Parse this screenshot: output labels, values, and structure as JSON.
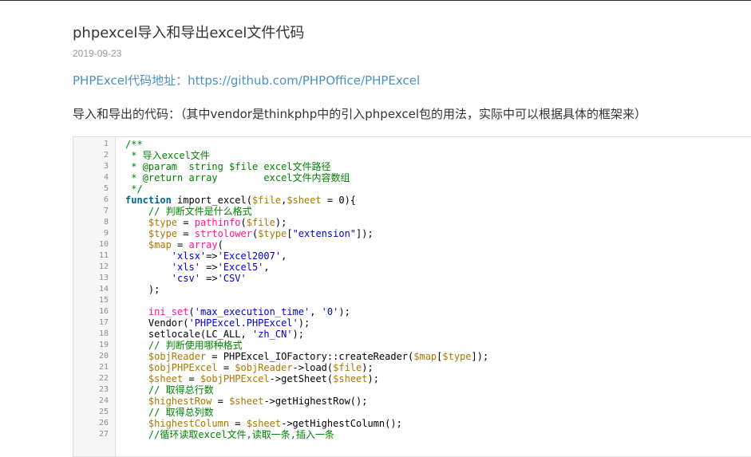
{
  "article": {
    "title": "phpexcel导入和导出excel文件代码",
    "date": "2019-09-23",
    "source_label": "PHPExcel代码地址",
    "source_colon": "：",
    "source_url": "https://github.com/PHPOffice/PHPExcel",
    "intro": "导入和导出的代码：（其中vendor是thinkphp中的引入phpexcel包的用法，实际中可以根据具体的框架来）"
  },
  "code": {
    "line_numbers": [
      "1",
      "2",
      "3",
      "4",
      "5",
      "6",
      "7",
      "8",
      "9",
      "10",
      "11",
      "12",
      "13",
      "14",
      "15",
      "16",
      "17",
      "18",
      "19",
      "20",
      "21",
      "22",
      "23",
      "24",
      "25",
      "26",
      "27"
    ],
    "lines": [
      [
        {
          "t": "/**",
          "c": "cm"
        }
      ],
      [
        {
          "t": " * 导入excel文件",
          "c": "cm"
        }
      ],
      [
        {
          "t": " * @param  string $file excel文件路径",
          "c": "cm"
        }
      ],
      [
        {
          "t": " * @return array        excel文件内容数组",
          "c": "cm"
        }
      ],
      [
        {
          "t": " */",
          "c": "cm"
        }
      ],
      [
        {
          "t": "function",
          "c": "kw"
        },
        {
          "t": " import_excel(",
          "c": "pl"
        },
        {
          "t": "$file",
          "c": "var"
        },
        {
          "t": ",",
          "c": "pl"
        },
        {
          "t": "$sheet",
          "c": "var"
        },
        {
          "t": " = 0){",
          "c": "pl"
        }
      ],
      [
        {
          "t": "    // 判断文件是什么格式",
          "c": "cm"
        }
      ],
      [
        {
          "t": "    ",
          "c": "pl"
        },
        {
          "t": "$type",
          "c": "var"
        },
        {
          "t": " = ",
          "c": "pl"
        },
        {
          "t": "pathinfo",
          "c": "fn"
        },
        {
          "t": "(",
          "c": "pl"
        },
        {
          "t": "$file",
          "c": "var"
        },
        {
          "t": ");",
          "c": "pl"
        }
      ],
      [
        {
          "t": "    ",
          "c": "pl"
        },
        {
          "t": "$type",
          "c": "var"
        },
        {
          "t": " = ",
          "c": "pl"
        },
        {
          "t": "strtolower",
          "c": "fn"
        },
        {
          "t": "(",
          "c": "pl"
        },
        {
          "t": "$type",
          "c": "var"
        },
        {
          "t": "[",
          "c": "pl"
        },
        {
          "t": "\"extension\"",
          "c": "st"
        },
        {
          "t": "]);",
          "c": "pl"
        }
      ],
      [
        {
          "t": "    ",
          "c": "pl"
        },
        {
          "t": "$map",
          "c": "var"
        },
        {
          "t": " = ",
          "c": "pl"
        },
        {
          "t": "array",
          "c": "fn"
        },
        {
          "t": "(",
          "c": "pl"
        }
      ],
      [
        {
          "t": "        ",
          "c": "pl"
        },
        {
          "t": "'xlsx'",
          "c": "st"
        },
        {
          "t": "=>",
          "c": "pl"
        },
        {
          "t": "'Excel2007'",
          "c": "st"
        },
        {
          "t": ",",
          "c": "pl"
        }
      ],
      [
        {
          "t": "        ",
          "c": "pl"
        },
        {
          "t": "'xls'",
          "c": "st"
        },
        {
          "t": " =>",
          "c": "pl"
        },
        {
          "t": "'Excel5'",
          "c": "st"
        },
        {
          "t": ",",
          "c": "pl"
        }
      ],
      [
        {
          "t": "        ",
          "c": "pl"
        },
        {
          "t": "'csv'",
          "c": "st"
        },
        {
          "t": " =>",
          "c": "pl"
        },
        {
          "t": "'CSV'",
          "c": "st"
        }
      ],
      [
        {
          "t": "    );",
          "c": "pl"
        }
      ],
      [
        {
          "t": "",
          "c": "pl"
        }
      ],
      [
        {
          "t": "    ",
          "c": "pl"
        },
        {
          "t": "ini_set",
          "c": "fn"
        },
        {
          "t": "(",
          "c": "pl"
        },
        {
          "t": "'max_execution_time'",
          "c": "st"
        },
        {
          "t": ", ",
          "c": "pl"
        },
        {
          "t": "'0'",
          "c": "st"
        },
        {
          "t": ");",
          "c": "pl"
        }
      ],
      [
        {
          "t": "    Vendor(",
          "c": "pl"
        },
        {
          "t": "'PHPExcel.PHPExcel'",
          "c": "st"
        },
        {
          "t": ");",
          "c": "pl"
        }
      ],
      [
        {
          "t": "    setlocale(LC_ALL, ",
          "c": "pl"
        },
        {
          "t": "'zh_CN'",
          "c": "st"
        },
        {
          "t": ");",
          "c": "pl"
        }
      ],
      [
        {
          "t": "    // 判断使用哪种格式",
          "c": "cm"
        }
      ],
      [
        {
          "t": "    ",
          "c": "pl"
        },
        {
          "t": "$objReader",
          "c": "var"
        },
        {
          "t": " = PHPExcel_IOFactory::createReader(",
          "c": "pl"
        },
        {
          "t": "$map",
          "c": "var"
        },
        {
          "t": "[",
          "c": "pl"
        },
        {
          "t": "$type",
          "c": "var"
        },
        {
          "t": "]);",
          "c": "pl"
        }
      ],
      [
        {
          "t": "    ",
          "c": "pl"
        },
        {
          "t": "$objPHPExcel",
          "c": "var"
        },
        {
          "t": " = ",
          "c": "pl"
        },
        {
          "t": "$objReader",
          "c": "var"
        },
        {
          "t": "->load(",
          "c": "pl"
        },
        {
          "t": "$file",
          "c": "var"
        },
        {
          "t": ");",
          "c": "pl"
        }
      ],
      [
        {
          "t": "    ",
          "c": "pl"
        },
        {
          "t": "$sheet",
          "c": "var"
        },
        {
          "t": " = ",
          "c": "pl"
        },
        {
          "t": "$objPHPExcel",
          "c": "var"
        },
        {
          "t": "->getSheet(",
          "c": "pl"
        },
        {
          "t": "$sheet",
          "c": "var"
        },
        {
          "t": ");",
          "c": "pl"
        }
      ],
      [
        {
          "t": "    // 取得总行数",
          "c": "cm"
        }
      ],
      [
        {
          "t": "    ",
          "c": "pl"
        },
        {
          "t": "$highestRow",
          "c": "var"
        },
        {
          "t": " = ",
          "c": "pl"
        },
        {
          "t": "$sheet",
          "c": "var"
        },
        {
          "t": "->getHighestRow();",
          "c": "pl"
        }
      ],
      [
        {
          "t": "    // 取得总列数",
          "c": "cm"
        }
      ],
      [
        {
          "t": "    ",
          "c": "pl"
        },
        {
          "t": "$highestColumn",
          "c": "var"
        },
        {
          "t": " = ",
          "c": "pl"
        },
        {
          "t": "$sheet",
          "c": "var"
        },
        {
          "t": "->getHighestColumn();",
          "c": "pl"
        }
      ],
      [
        {
          "t": "    //循环读取excel文件,读取一条,插入一条",
          "c": "cm"
        }
      ]
    ]
  }
}
